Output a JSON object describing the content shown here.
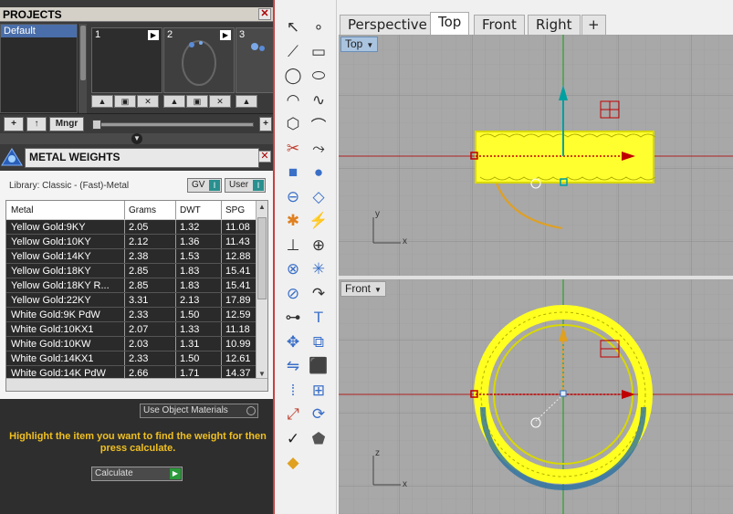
{
  "projects": {
    "title": "PROJECTS",
    "items": [
      "Default"
    ],
    "thumbnails": [
      "1",
      "2",
      "3"
    ],
    "buttons": {
      "add": "+",
      "up": "↑",
      "manager": "Mngr",
      "plus": "+"
    }
  },
  "metal_weights": {
    "title": "METAL WEIGHTS",
    "library": "Library: Classic - (Fast)-Metal",
    "gv_label": "GV",
    "user_label": "User",
    "columns": [
      "Metal",
      "Grams",
      "DWT",
      "SPG"
    ],
    "rows": [
      {
        "metal": "Yellow Gold:9KY",
        "grams": "2.05",
        "dwt": "1.32",
        "spg": "11.08"
      },
      {
        "metal": "Yellow Gold:10KY",
        "grams": "2.12",
        "dwt": "1.36",
        "spg": "11.43"
      },
      {
        "metal": "Yellow Gold:14KY",
        "grams": "2.38",
        "dwt": "1.53",
        "spg": "12.88"
      },
      {
        "metal": "Yellow Gold:18KY",
        "grams": "2.85",
        "dwt": "1.83",
        "spg": "15.41"
      },
      {
        "metal": "Yellow Gold:18KY R...",
        "grams": "2.85",
        "dwt": "1.83",
        "spg": "15.41"
      },
      {
        "metal": "Yellow Gold:22KY",
        "grams": "3.31",
        "dwt": "2.13",
        "spg": "17.89"
      },
      {
        "metal": "White Gold:9K PdW",
        "grams": "2.33",
        "dwt": "1.50",
        "spg": "12.59"
      },
      {
        "metal": "White Gold:10KX1",
        "grams": "2.07",
        "dwt": "1.33",
        "spg": "11.18"
      },
      {
        "metal": "White Gold:10KW",
        "grams": "2.03",
        "dwt": "1.31",
        "spg": "10.99"
      },
      {
        "metal": "White Gold:14KX1",
        "grams": "2.33",
        "dwt": "1.50",
        "spg": "12.61"
      },
      {
        "metal": "White Gold:14K PdW",
        "grams": "2.66",
        "dwt": "1.71",
        "spg": "14.37"
      }
    ],
    "use_object_materials": "Use Object Materials",
    "hint": "Highlight the item you want to find the weight for then press calculate.",
    "calculate": "Calculate"
  },
  "viewport_tabs": [
    "Perspective",
    "Top",
    "Front",
    "Right",
    "+"
  ],
  "active_tab": "Top",
  "viewports": {
    "top": {
      "label": "Top",
      "axis_x": "x",
      "axis_y": "y"
    },
    "front": {
      "label": "Front",
      "axis_x": "x",
      "axis_z": "z"
    }
  },
  "colors": {
    "panel_dark": "#3a3a3a",
    "selection_yellow": "#ffff00",
    "axis_red": "#c00000",
    "axis_green": "#00a000",
    "gizmo_teal": "#00a0a0",
    "hint_text": "#f0c020",
    "viewport_bg": "#a8a8a8"
  },
  "toolbar_icons": [
    "select-arrow-icon",
    "point-icon",
    "polyline-icon",
    "rectangle-icon",
    "circle-icon",
    "ellipse-icon",
    "arc-icon",
    "curve-icon",
    "polygon-icon",
    "fillet-icon",
    "trim-icon",
    "extend-icon",
    "box-icon",
    "sphere-icon",
    "cylinder-icon",
    "plane-icon",
    "gear-settings-icon",
    "lightning-icon",
    "split-icon",
    "join-icon",
    "boolean-union-icon",
    "explode-icon",
    "boolean-diff-icon",
    "sweep-icon",
    "curve-tools-icon",
    "text-icon",
    "move-icon",
    "copy-icon",
    "mirror-icon",
    "box-edit-icon",
    "array-icon",
    "grid-array-icon",
    "scale-icon",
    "rotate-icon",
    "check-icon",
    "shape-icon",
    "render-icon"
  ]
}
